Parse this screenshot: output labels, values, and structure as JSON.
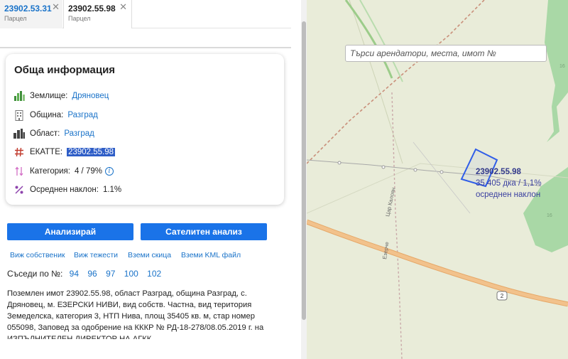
{
  "tabs": [
    {
      "title": "23902.53.31",
      "subtitle": "Парцел",
      "close": "✕"
    },
    {
      "title": "23902.55.98",
      "subtitle": "Парцел",
      "close": "✕"
    }
  ],
  "info": {
    "title": "Обща информация",
    "zemlishte": {
      "label": "Землище:",
      "value": "Дряновец"
    },
    "obshtina": {
      "label": "Община:",
      "value": "Разград"
    },
    "oblast": {
      "label": "Област:",
      "value": "Разград"
    },
    "ekatte": {
      "label": "ЕКАТТЕ:",
      "value": "23902.55.98"
    },
    "kategoria": {
      "label": "Категория:",
      "value": "4 / 79%",
      "info_glyph": "i"
    },
    "naklon": {
      "label": "Осреднен наклон:",
      "value": "1.1%"
    }
  },
  "buttons": {
    "analyze": "Анализирай",
    "satellite": "Сателитен анализ"
  },
  "links": {
    "owner": "Виж собственик",
    "tezhesti": "Виж тежести",
    "skica": "Вземи скица",
    "kml": "Вземи KML файл"
  },
  "neighbors": {
    "label": "Съседи по №:",
    "items": [
      "94",
      "96",
      "97",
      "100",
      "102"
    ]
  },
  "description": "Поземлен имот 23902.55.98, област Разград, община Разград, с. Дряновец, м. ЕЗЕРСКИ НИВИ, вид собств. Частна, вид територия Земеделска, категория 3, НТП Нива, площ 35405 кв. м, стар номер 055098, Заповед за одобрение на КККР № РД-18-278/08.05.2019 г. на ИЗПЪЛНИТЕЛЕН ДИРЕКТОР НА АГКК",
  "map": {
    "search_placeholder": "Търси арендатори, места, имот №",
    "parcel_id": "23902.55.98",
    "parcel_area": "35.405 дка / 1,1%",
    "parcel_slope": "осреднен наклон",
    "road_labels": [
      "Цар Калоян",
      "Езерче"
    ],
    "road_number": "2",
    "block_numbers": [
      "16",
      "16"
    ]
  },
  "colors": {
    "accent": "#1a73e8",
    "link": "#1a73c9",
    "parcel_outline": "#2f5de8",
    "map_background": "#e9ecd9",
    "forest": "#a9d8a6",
    "main_road": "#f2c28c"
  }
}
